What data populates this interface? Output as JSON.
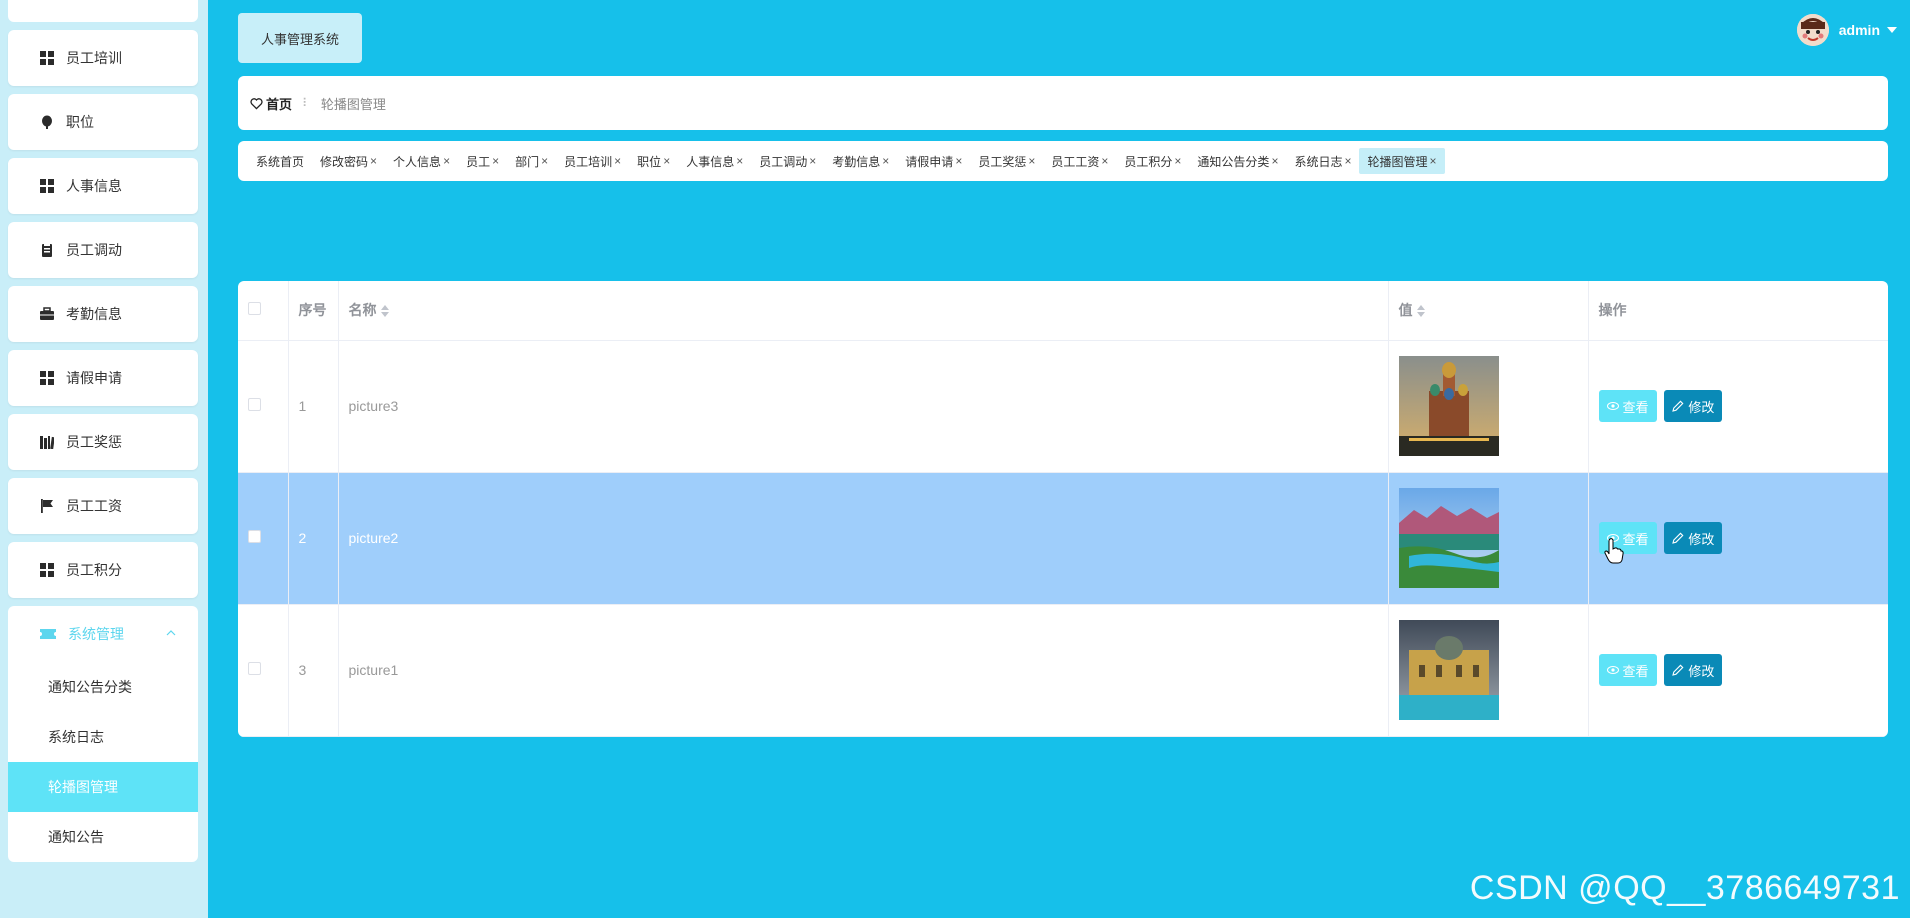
{
  "app": {
    "title": "人事管理系统"
  },
  "user": {
    "name": "admin"
  },
  "sidebar": {
    "items": [
      {
        "label": "员工培训",
        "icon": "grid-icon"
      },
      {
        "label": "职位",
        "icon": "balloon-icon"
      },
      {
        "label": "人事信息",
        "icon": "grid-icon"
      },
      {
        "label": "员工调动",
        "icon": "clipboard-icon"
      },
      {
        "label": "考勤信息",
        "icon": "briefcase-icon"
      },
      {
        "label": "请假申请",
        "icon": "grid-icon"
      },
      {
        "label": "员工奖惩",
        "icon": "books-icon"
      },
      {
        "label": "员工工资",
        "icon": "flag-icon"
      },
      {
        "label": "员工积分",
        "icon": "grid-icon"
      }
    ],
    "system": {
      "label": "系统管理",
      "icon": "ticket-icon",
      "children": [
        {
          "label": "通知公告分类"
        },
        {
          "label": "系统日志"
        },
        {
          "label": "轮播图管理"
        },
        {
          "label": "通知公告"
        }
      ]
    }
  },
  "breadcrumb": {
    "home": "首页",
    "separator": "⠇",
    "current": "轮播图管理"
  },
  "tabs": [
    {
      "label": "系统首页",
      "closable": false
    },
    {
      "label": "修改密码",
      "closable": true
    },
    {
      "label": "个人信息",
      "closable": true
    },
    {
      "label": "员工",
      "closable": true
    },
    {
      "label": "部门",
      "closable": true
    },
    {
      "label": "员工培训",
      "closable": true
    },
    {
      "label": "职位",
      "closable": true
    },
    {
      "label": "人事信息",
      "closable": true
    },
    {
      "label": "员工调动",
      "closable": true
    },
    {
      "label": "考勤信息",
      "closable": true
    },
    {
      "label": "请假申请",
      "closable": true
    },
    {
      "label": "员工奖惩",
      "closable": true
    },
    {
      "label": "员工工资",
      "closable": true
    },
    {
      "label": "员工积分",
      "closable": true
    },
    {
      "label": "通知公告分类",
      "closable": true
    },
    {
      "label": "系统日志",
      "closable": true
    },
    {
      "label": "轮播图管理",
      "closable": true
    }
  ],
  "table": {
    "headers": {
      "index": "序号",
      "name": "名称",
      "value": "值",
      "actions": "操作"
    },
    "rows": [
      {
        "index": "1",
        "name": "picture3",
        "image": "cathedral-photo"
      },
      {
        "index": "2",
        "name": "picture2",
        "image": "lake-mountains-photo"
      },
      {
        "index": "3",
        "name": "picture1",
        "image": "bathhouse-photo"
      }
    ],
    "view_label": "查看",
    "edit_label": "修改"
  },
  "watermark": "CSDN @QQ__3786649731",
  "colors": {
    "background": "#16c0ea",
    "sidebar_bg": "#c9eef8",
    "accent": "#5ee3f7",
    "edit_button": "#0a8ab7",
    "highlight_row": "#9fcefb"
  }
}
